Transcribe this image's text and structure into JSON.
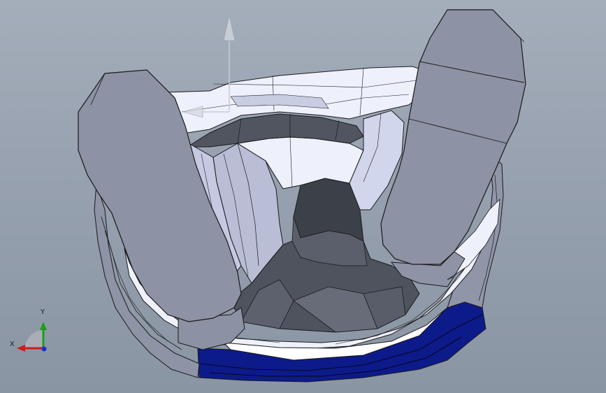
{
  "viewport": {
    "background_top": "#a4aebb",
    "background_bottom": "#8a95a4"
  },
  "model": {
    "light_face": "#e8ecfb",
    "mid_face": "#c8cde2",
    "dark_face": "#8e93a6",
    "shadow_face": "#555a66",
    "pad_face": "#8d92a4",
    "selected_face": "#0d1a8a",
    "edge_color": "#1a1a1a"
  },
  "triad": {
    "x_label": "X",
    "y_label": "Y",
    "x_color": "#d11a1a",
    "y_color": "#1aa01a",
    "z_color": "#1a2fd1"
  },
  "direction_arrow": {
    "icon": "view-direction-arrow-icon",
    "color": "#c8ccd4"
  }
}
